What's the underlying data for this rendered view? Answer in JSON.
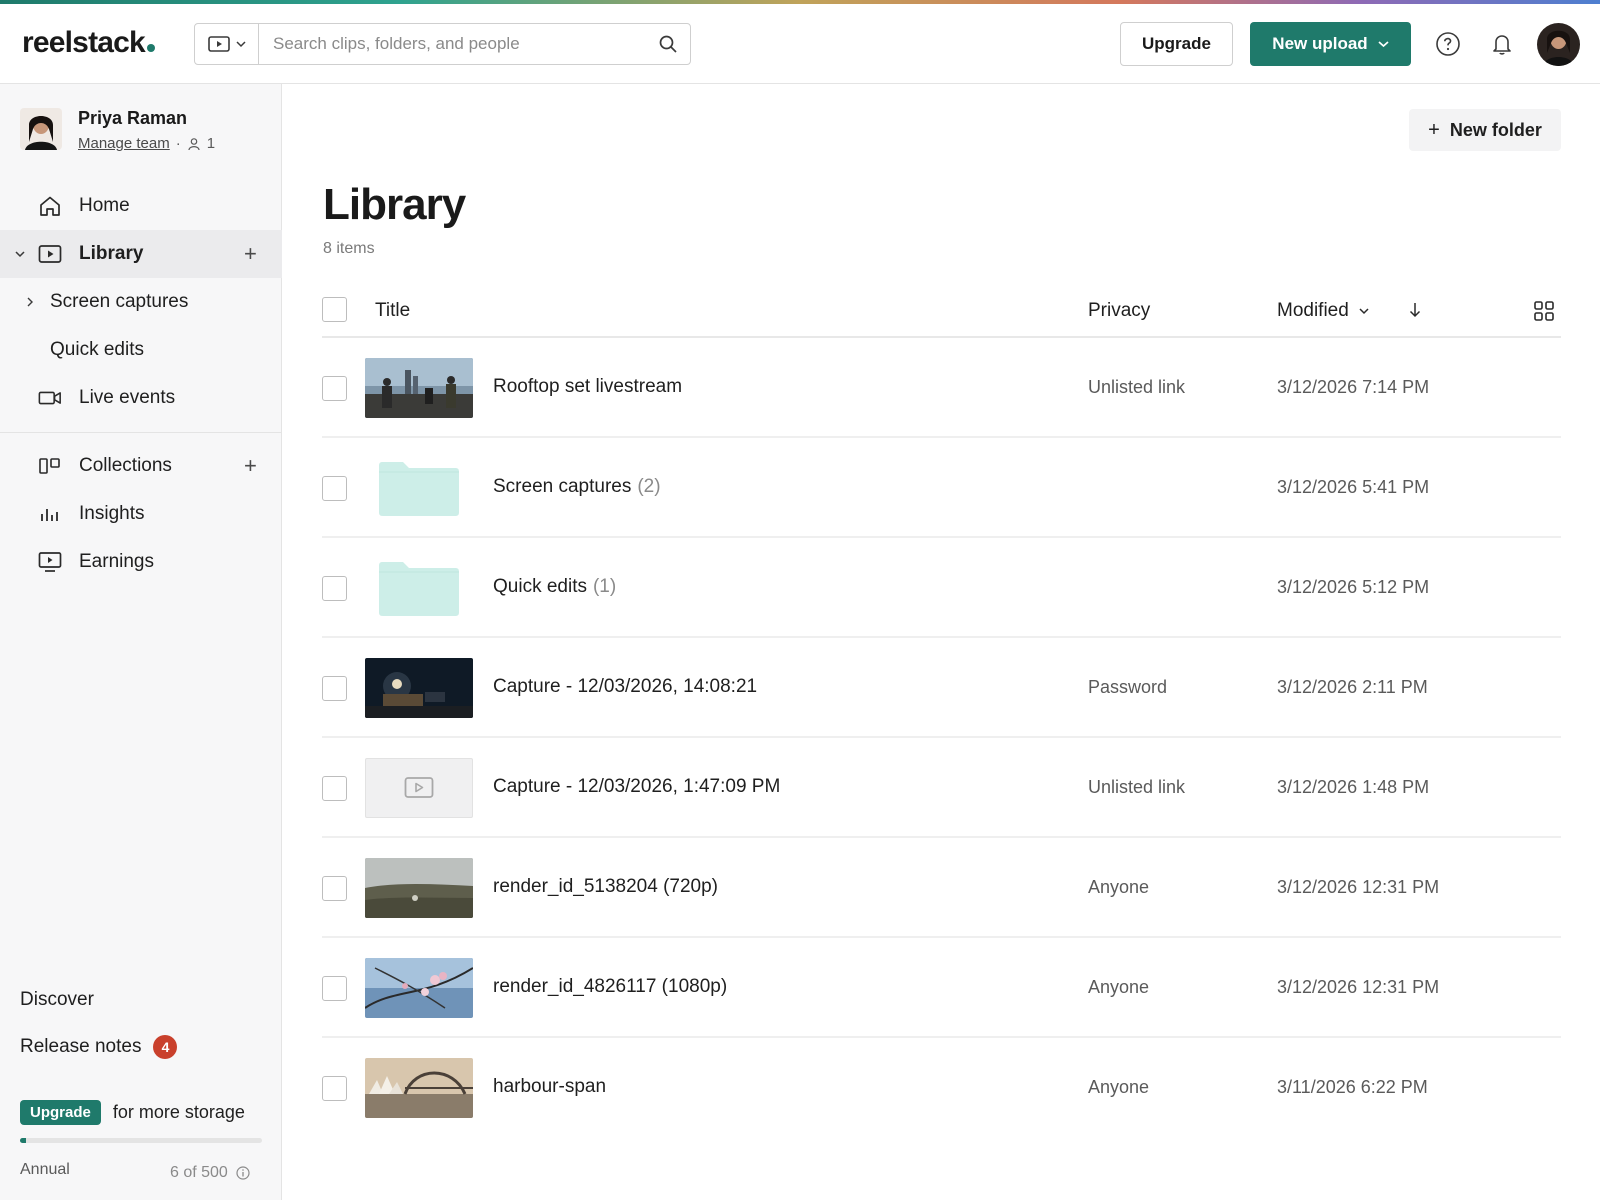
{
  "header": {
    "logo": "reelstack",
    "search_placeholder": "Search clips, folders, and people",
    "upgrade_label": "Upgrade",
    "new_upload_label": "New upload"
  },
  "sidebar": {
    "user": {
      "name": "Priya Raman",
      "manage_label": "Manage team",
      "seats": "1"
    },
    "nav": {
      "home": "Home",
      "library": "Library",
      "screen_captures": "Screen captures",
      "quick_edits": "Quick edits",
      "live_events": "Live events",
      "collections": "Collections",
      "insights": "Insights",
      "earnings": "Earnings"
    },
    "discover": "Discover",
    "release_notes": "Release notes",
    "release_notes_count": "4",
    "storage": {
      "upgrade_label": "Upgrade",
      "more_text": "for more storage",
      "plan": "Annual",
      "usage": "6 of 500",
      "used_fraction": 0.012
    }
  },
  "main": {
    "new_folder_label": "New folder",
    "title": "Library",
    "item_count": "8 items",
    "columns": {
      "title": "Title",
      "privacy": "Privacy",
      "modified": "Modified"
    },
    "rows": [
      {
        "title": "Rooftop set livestream",
        "count": "",
        "privacy": "Unlisted link",
        "modified": "3/12/2026 7:14 PM",
        "thumb": "rooftop-thumb"
      },
      {
        "title": "Screen captures",
        "count": "(2)",
        "privacy": "",
        "modified": "3/12/2026 5:41 PM",
        "thumb": "folder"
      },
      {
        "title": "Quick edits",
        "count": "(1)",
        "privacy": "",
        "modified": "3/12/2026 5:12 PM",
        "thumb": "folder"
      },
      {
        "title": "Capture - 12/03/2026, 14:08:21",
        "count": "",
        "privacy": "Password",
        "modified": "3/12/2026 2:11 PM",
        "thumb": "dark-room-thumb"
      },
      {
        "title": "Capture - 12/03/2026, 1:47:09 PM",
        "count": "",
        "privacy": "Unlisted link",
        "modified": "3/12/2026 1:48 PM",
        "thumb": "placeholder"
      },
      {
        "title": "render_id_5138204 (720p)",
        "count": "",
        "privacy": "Anyone",
        "modified": "3/12/2026 12:31 PM",
        "thumb": "foggy-field-thumb"
      },
      {
        "title": "render_id_4826117 (1080p)",
        "count": "",
        "privacy": "Anyone",
        "modified": "3/12/2026 12:31 PM",
        "thumb": "blossom-thumb"
      },
      {
        "title": "harbour-span",
        "count": "",
        "privacy": "Anyone",
        "modified": "3/11/2026 6:22 PM",
        "thumb": "harbour-thumb"
      }
    ]
  },
  "colors": {
    "accent": "#1f7a6b",
    "badge": "#c9402c",
    "folder": "#cdeee8"
  }
}
